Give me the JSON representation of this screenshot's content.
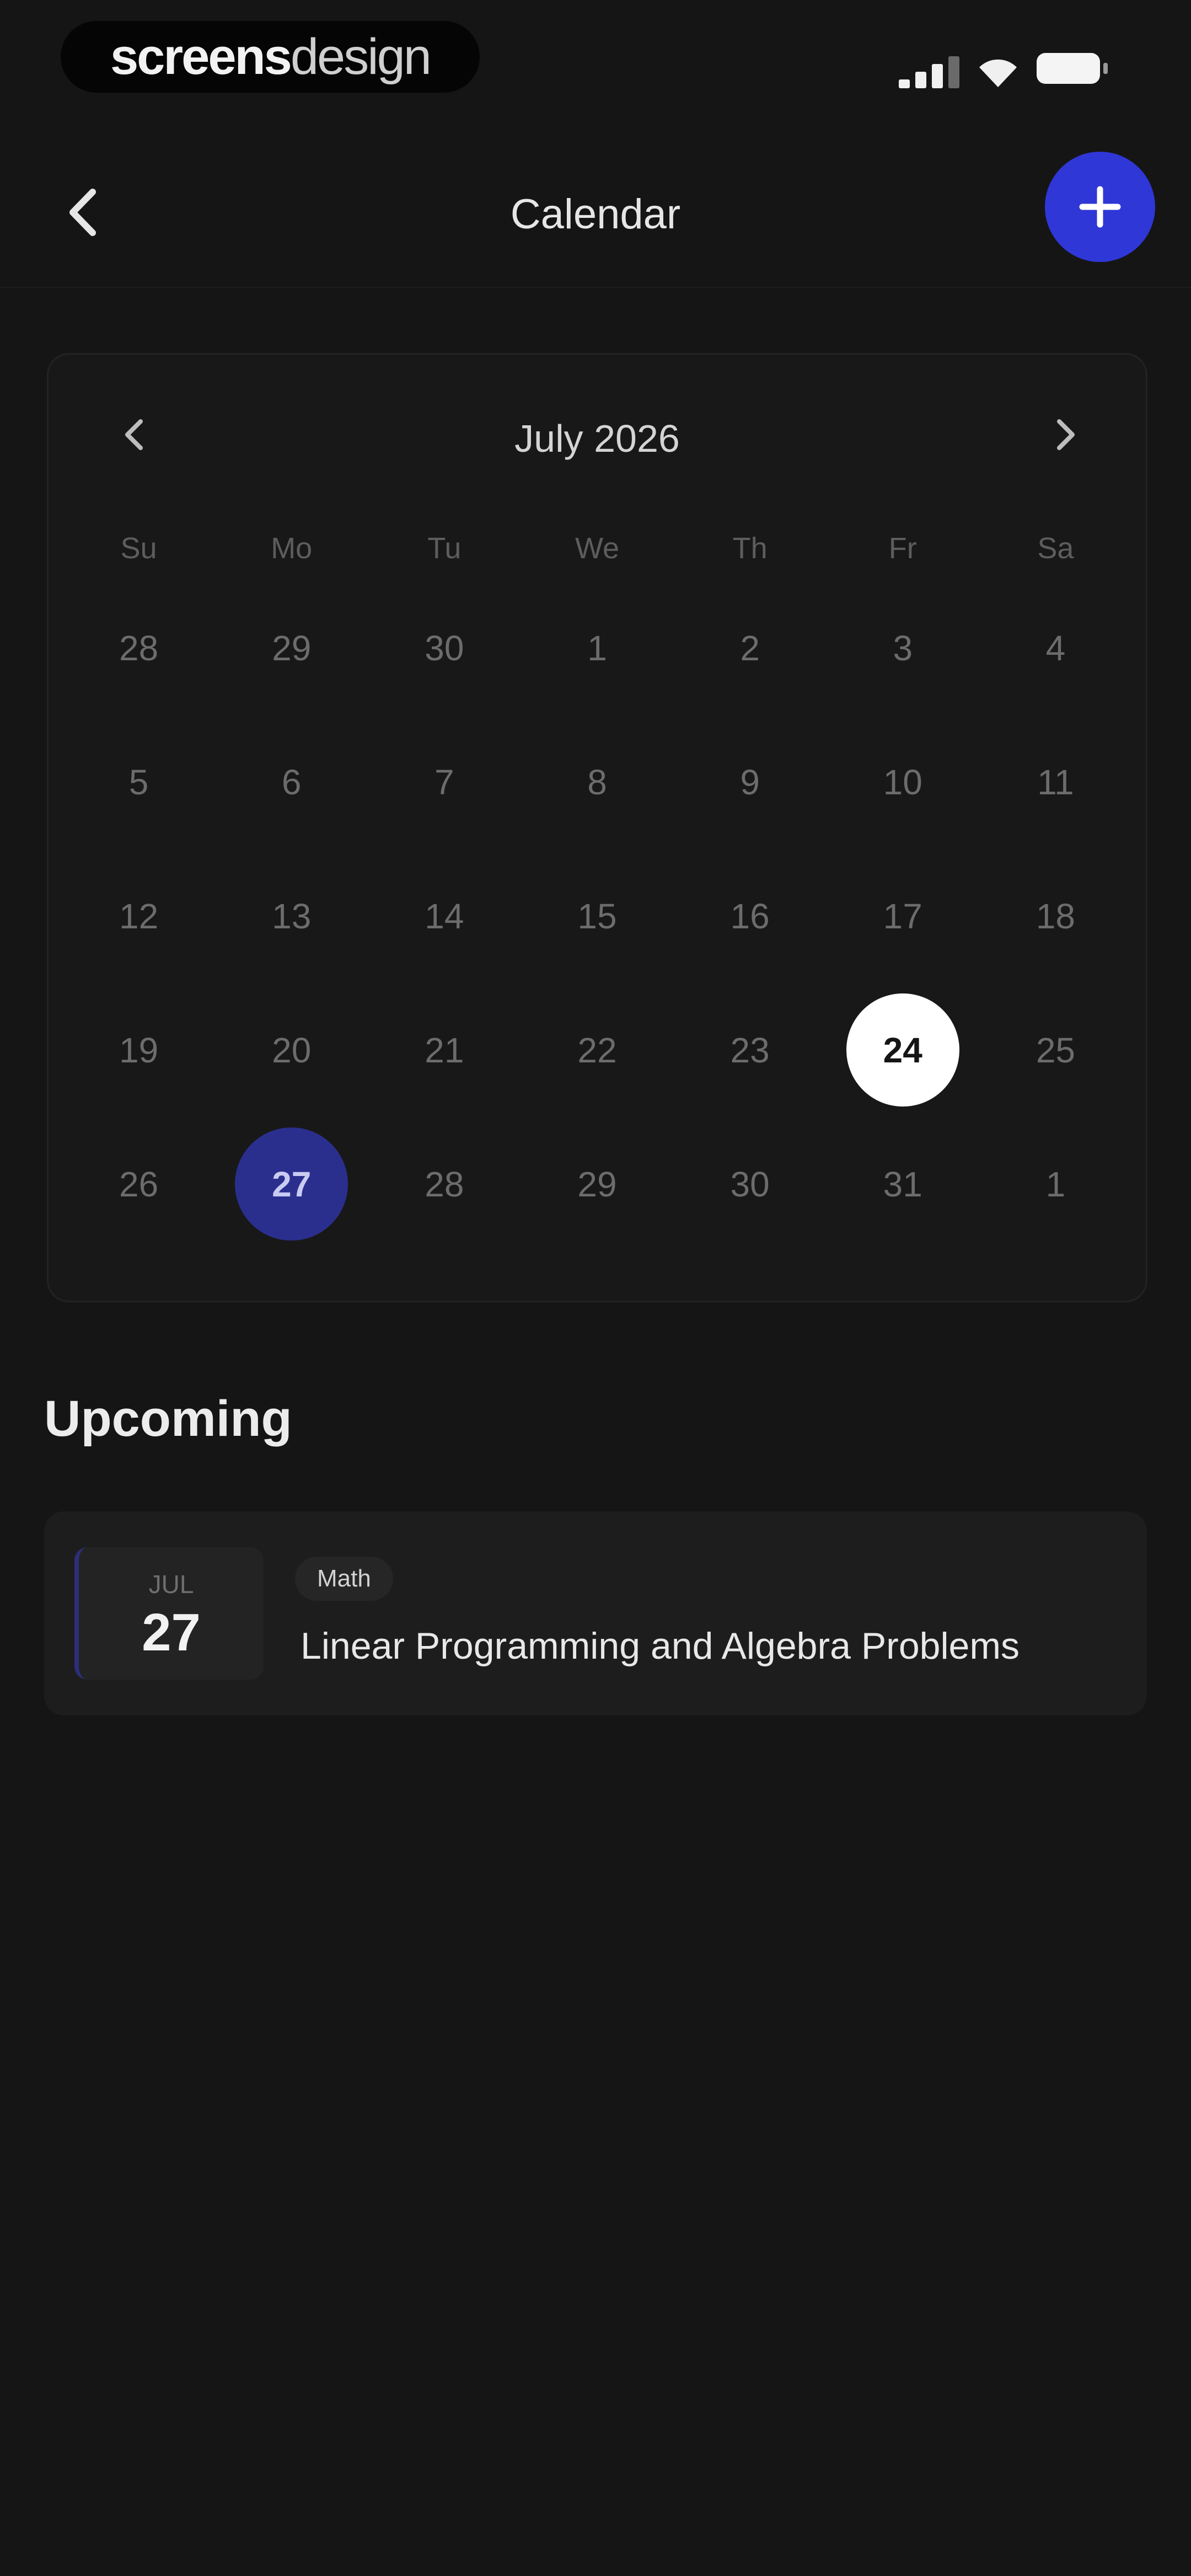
{
  "status_bar": {
    "brand": {
      "bold": "screens",
      "light": "design"
    },
    "icons": [
      "signal-icon",
      "wifi-icon",
      "battery-icon"
    ]
  },
  "header": {
    "title": "Calendar",
    "back_icon": "chevron-left-icon",
    "add_icon": "plus-icon"
  },
  "calendar": {
    "month_label": "July 2026",
    "weekdays": [
      "Su",
      "Mo",
      "Tu",
      "We",
      "Th",
      "Fr",
      "Sa"
    ],
    "days": [
      {
        "d": "28",
        "state": ""
      },
      {
        "d": "29",
        "state": ""
      },
      {
        "d": "30",
        "state": ""
      },
      {
        "d": "1",
        "state": ""
      },
      {
        "d": "2",
        "state": ""
      },
      {
        "d": "3",
        "state": ""
      },
      {
        "d": "4",
        "state": ""
      },
      {
        "d": "5",
        "state": ""
      },
      {
        "d": "6",
        "state": ""
      },
      {
        "d": "7",
        "state": ""
      },
      {
        "d": "8",
        "state": ""
      },
      {
        "d": "9",
        "state": ""
      },
      {
        "d": "10",
        "state": ""
      },
      {
        "d": "11",
        "state": ""
      },
      {
        "d": "12",
        "state": ""
      },
      {
        "d": "13",
        "state": ""
      },
      {
        "d": "14",
        "state": ""
      },
      {
        "d": "15",
        "state": ""
      },
      {
        "d": "16",
        "state": ""
      },
      {
        "d": "17",
        "state": ""
      },
      {
        "d": "18",
        "state": ""
      },
      {
        "d": "19",
        "state": ""
      },
      {
        "d": "20",
        "state": ""
      },
      {
        "d": "21",
        "state": ""
      },
      {
        "d": "22",
        "state": ""
      },
      {
        "d": "23",
        "state": ""
      },
      {
        "d": "24",
        "state": "today"
      },
      {
        "d": "25",
        "state": ""
      },
      {
        "d": "26",
        "state": ""
      },
      {
        "d": "27",
        "state": "selected"
      },
      {
        "d": "28",
        "state": ""
      },
      {
        "d": "29",
        "state": ""
      },
      {
        "d": "30",
        "state": ""
      },
      {
        "d": "31",
        "state": ""
      },
      {
        "d": "1",
        "state": ""
      }
    ]
  },
  "upcoming": {
    "title": "Upcoming",
    "events": [
      {
        "month": "JUL",
        "day": "27",
        "tag": "Math",
        "title": "Linear Programming and Algebra Problems"
      }
    ]
  },
  "colors": {
    "background": "#151515",
    "accent": "#2f37d6",
    "selected_day": "#2a2f8e",
    "today": "#ffffff"
  }
}
